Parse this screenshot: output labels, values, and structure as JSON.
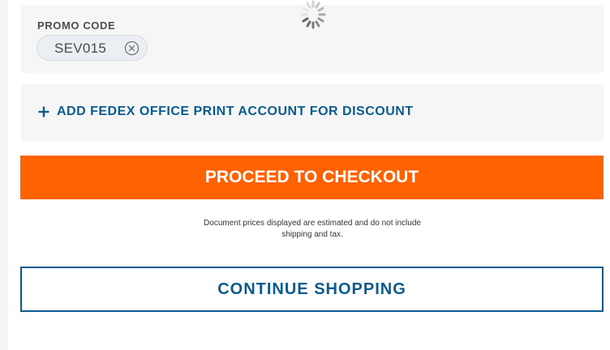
{
  "promo": {
    "label": "PROMO CODE",
    "applied_code": "SEV015",
    "remove_icon": "close-circle-icon"
  },
  "loading": {
    "icon": "spinner-icon"
  },
  "fedex_print": {
    "link_label": "ADD FEDEX OFFICE PRINT ACCOUNT FOR DISCOUNT",
    "icon": "plus-icon"
  },
  "checkout": {
    "label": "PROCEED TO CHECKOUT"
  },
  "disclaimer": {
    "line1": "Document prices displayed are estimated and do not include",
    "line2": "shipping and tax."
  },
  "continue": {
    "label": "CONTINUE SHOPPING"
  },
  "colors": {
    "accent_orange": "#ff6200",
    "link_blue": "#0b5c8e",
    "panel_gray": "#f6f6f6"
  }
}
